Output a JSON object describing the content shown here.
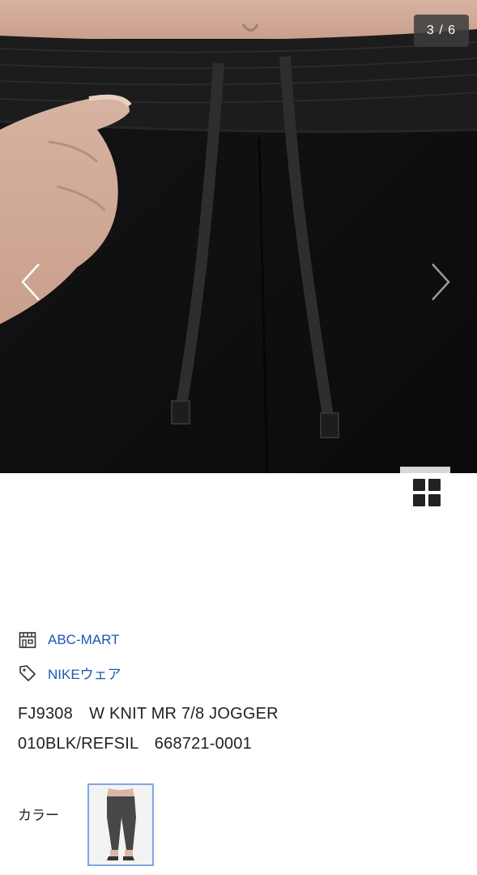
{
  "gallery": {
    "counter": "3 / 6",
    "prev_icon": "chevron-left-icon",
    "next_icon": "chevron-right-icon",
    "grid_icon": "grid-view-icon"
  },
  "shop": {
    "icon": "store-icon",
    "label": "ABC-MART"
  },
  "category": {
    "icon": "tag-icon",
    "label": "NIKEウェア"
  },
  "product": {
    "line1": "FJ9308　W KNIT MR 7/8 JOGGER",
    "line2": "010BLK/REFSIL　668721-0001"
  },
  "color": {
    "label": "カラー",
    "swatch_alt": "black jogger pants thumbnail"
  },
  "colors": {
    "link": "#1f56b5",
    "swatch_border": "#7fa8e6",
    "photo_bg": "#111111"
  }
}
